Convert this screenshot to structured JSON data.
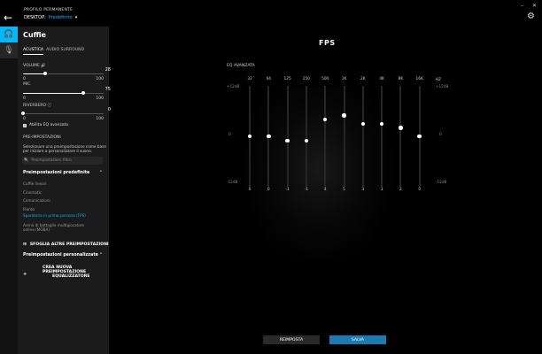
{
  "header": {
    "profile_label": "PROFILO PERMANENTE",
    "profile_prefix": "DESKTOP:",
    "profile_name": "Predefinito"
  },
  "panel": {
    "title": "Cuffie",
    "tabs": [
      "ACUSTICA",
      "AUDIO SURROUND"
    ],
    "volume": {
      "label": "VOLUME",
      "min": "0",
      "max": "100",
      "value": "28",
      "fraction": 0.28
    },
    "mic": {
      "label": "MIC",
      "min": "0",
      "max": "100",
      "value": "75",
      "fraction": 0.75
    },
    "reverb": {
      "label": "RIVERBERO",
      "min": "0",
      "max": "100",
      "value": "0",
      "fraction": 0.0
    },
    "eq_checkbox": "Abilita EQ avanzato",
    "presets_label": "PRE-IMPOSTAZIONI",
    "presets_desc": "Selezionare una preimpostazione come base per iniziare a personalizzare il suono.",
    "search_placeholder": "Preimpostazioni filtro",
    "default_group": "Preimpostazioni predefinite",
    "default_items": [
      "Cuffie lineari",
      "Cinematic",
      "Comunicazioni",
      "Pianto",
      "Sparatorie in prima persona (FPS)",
      "Arena di battaglie multigiocatore online (MOBA)"
    ],
    "browse": "SFOGLIA ALTRE PREIMPOSTAZIONI",
    "custom_group": "Preimpostazioni personalizzate",
    "create_line1": "CREA NUOVA PREIMPOSTAZIONE",
    "create_line2": "EQUALIZZATORE"
  },
  "main": {
    "title": "FPS",
    "eq_label": "EQ AVANZATA",
    "hz_label": "HZ",
    "db_top": "+12dB",
    "db_mid": "0",
    "db_bot": "-12dB",
    "reset": "REIMPOSTA",
    "save": "SALVA"
  },
  "eq_bands": [
    {
      "freq": "32",
      "value": "0",
      "gain": 0
    },
    {
      "freq": "64",
      "value": "0",
      "gain": 0
    },
    {
      "freq": "125",
      "value": "-1",
      "gain": -1
    },
    {
      "freq": "250",
      "value": "-1",
      "gain": -1
    },
    {
      "freq": "500",
      "value": "4",
      "gain": 4
    },
    {
      "freq": "1K",
      "value": "5",
      "gain": 5
    },
    {
      "freq": "2K",
      "value": "3",
      "gain": 3
    },
    {
      "freq": "4K",
      "value": "3",
      "gain": 3
    },
    {
      "freq": "8K",
      "value": "2",
      "gain": 2
    },
    {
      "freq": "16K",
      "value": "0",
      "gain": 0
    }
  ],
  "colors": {
    "accent": "#00b8fc",
    "save": "#1a7cb0"
  }
}
